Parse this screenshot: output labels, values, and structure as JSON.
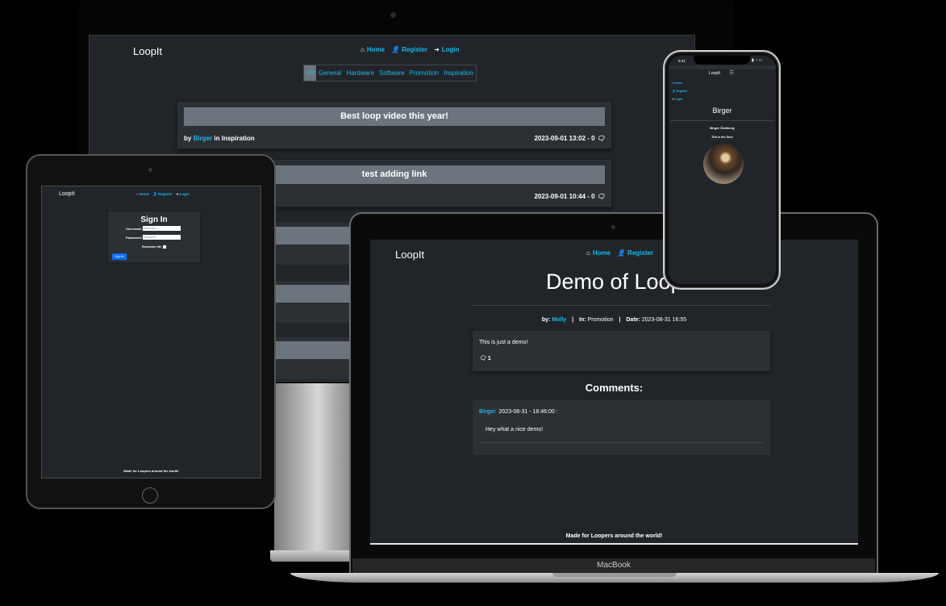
{
  "desktop": {
    "brand": "LoopIt",
    "nav": [
      "Home",
      "Register",
      "Login"
    ],
    "categories": [
      "All",
      "General",
      "Hardware",
      "Software",
      "Promotion",
      "Inspiration"
    ],
    "posts": [
      {
        "title": "Best loop video this year!",
        "by": "by",
        "author": "Birger",
        "in": "in",
        "category": "Inspiration",
        "datetime": "2023-09-01 13:02 - 0"
      },
      {
        "title": "test adding link",
        "datetime": "2023-09-01 10:44 - 0"
      }
    ]
  },
  "tablet": {
    "brand": "LoopIt",
    "nav": [
      "Home",
      "Register",
      "Login"
    ],
    "signin_title": "Sign In",
    "username_label": "Username:",
    "username_placeholder": "Username",
    "password_label": "Password:",
    "password_placeholder": "Password",
    "remember": "Remember Me",
    "button": "Sign In",
    "footer": "Made for Loopers around the world!"
  },
  "laptop": {
    "brand": "LoopIt",
    "nav": [
      "Home",
      "Register"
    ],
    "title": "Demo of LoopIt",
    "meta": {
      "by_label": "by:",
      "author": "Molly",
      "in_label": "In:",
      "category": "Promotion",
      "date_label": "Date:",
      "date": "2023-08-31 16:55"
    },
    "post_text": "This is just a demo!",
    "comment_count": "1",
    "comments_heading": "Comments:",
    "comment": {
      "author": "Birger",
      "datetime": "2023-08-31 - 18:46:00 :",
      "text": "Hey what a nice demo!"
    },
    "footer": "Made for Loopers around the world!",
    "device_label": "MacBook"
  },
  "phone": {
    "time": "9:41",
    "brand": "LoopIt",
    "nav": [
      "Home",
      "Register",
      "Login"
    ],
    "username": "Birger",
    "full_name": "Birger Östeberg",
    "bio": "This is the Guru"
  }
}
